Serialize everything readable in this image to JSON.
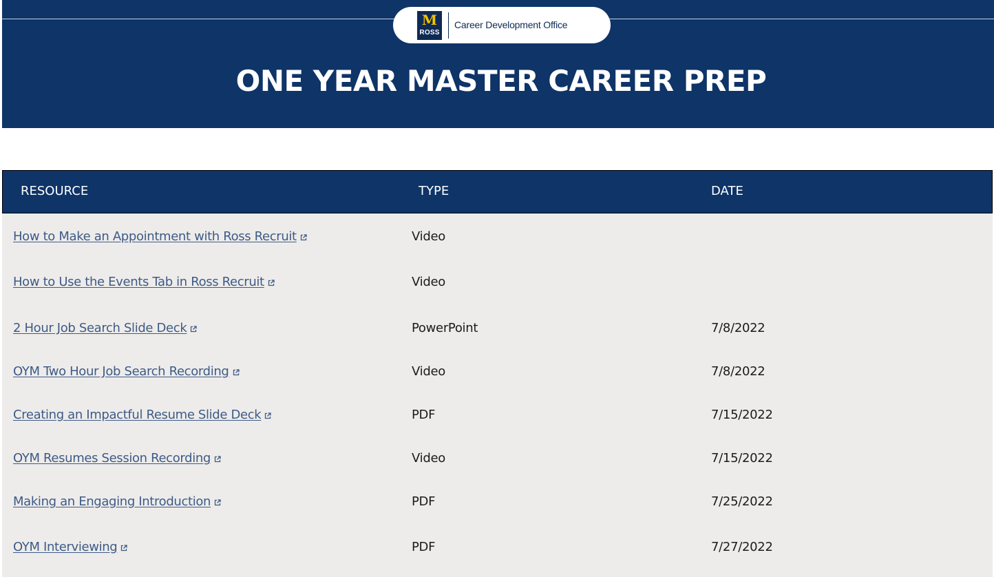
{
  "header": {
    "logo": {
      "mark": "M",
      "school": "ROSS",
      "office": "Career Development Office"
    },
    "title": "ONE YEAR MASTER CAREER PREP"
  },
  "table": {
    "columns": {
      "resource": "RESOURCE",
      "type": "TYPE",
      "date": "DATE"
    },
    "rows": [
      {
        "resource": "How to Make an Appointment with Ross Recruit",
        "type": "Video",
        "date": ""
      },
      {
        "resource": "How to Use the Events Tab in Ross Recruit",
        "type": "Video",
        "date": ""
      },
      {
        "resource": "2 Hour Job Search Slide Deck",
        "type": "PowerPoint",
        "date": "7/8/2022"
      },
      {
        "resource": "OYM Two Hour Job Search Recording",
        "type": "Video",
        "date": "7/8/2022"
      },
      {
        "resource": "Creating an Impactful Resume Slide Deck",
        "type": "PDF",
        "date": "7/15/2022"
      },
      {
        "resource": "OYM Resumes Session Recording",
        "type": "Video",
        "date": "7/15/2022"
      },
      {
        "resource": "Making an Engaging Introduction",
        "type": "PDF",
        "date": "7/25/2022"
      },
      {
        "resource": "OYM Interviewing",
        "type": "PDF",
        "date": "7/27/2022"
      }
    ]
  },
  "icons": {
    "external_link": "external-link-icon"
  },
  "colors": {
    "brand_navy": "#0e3468",
    "maize": "#f2c200",
    "link": "#3e5a86",
    "table_body": "#edecea"
  }
}
